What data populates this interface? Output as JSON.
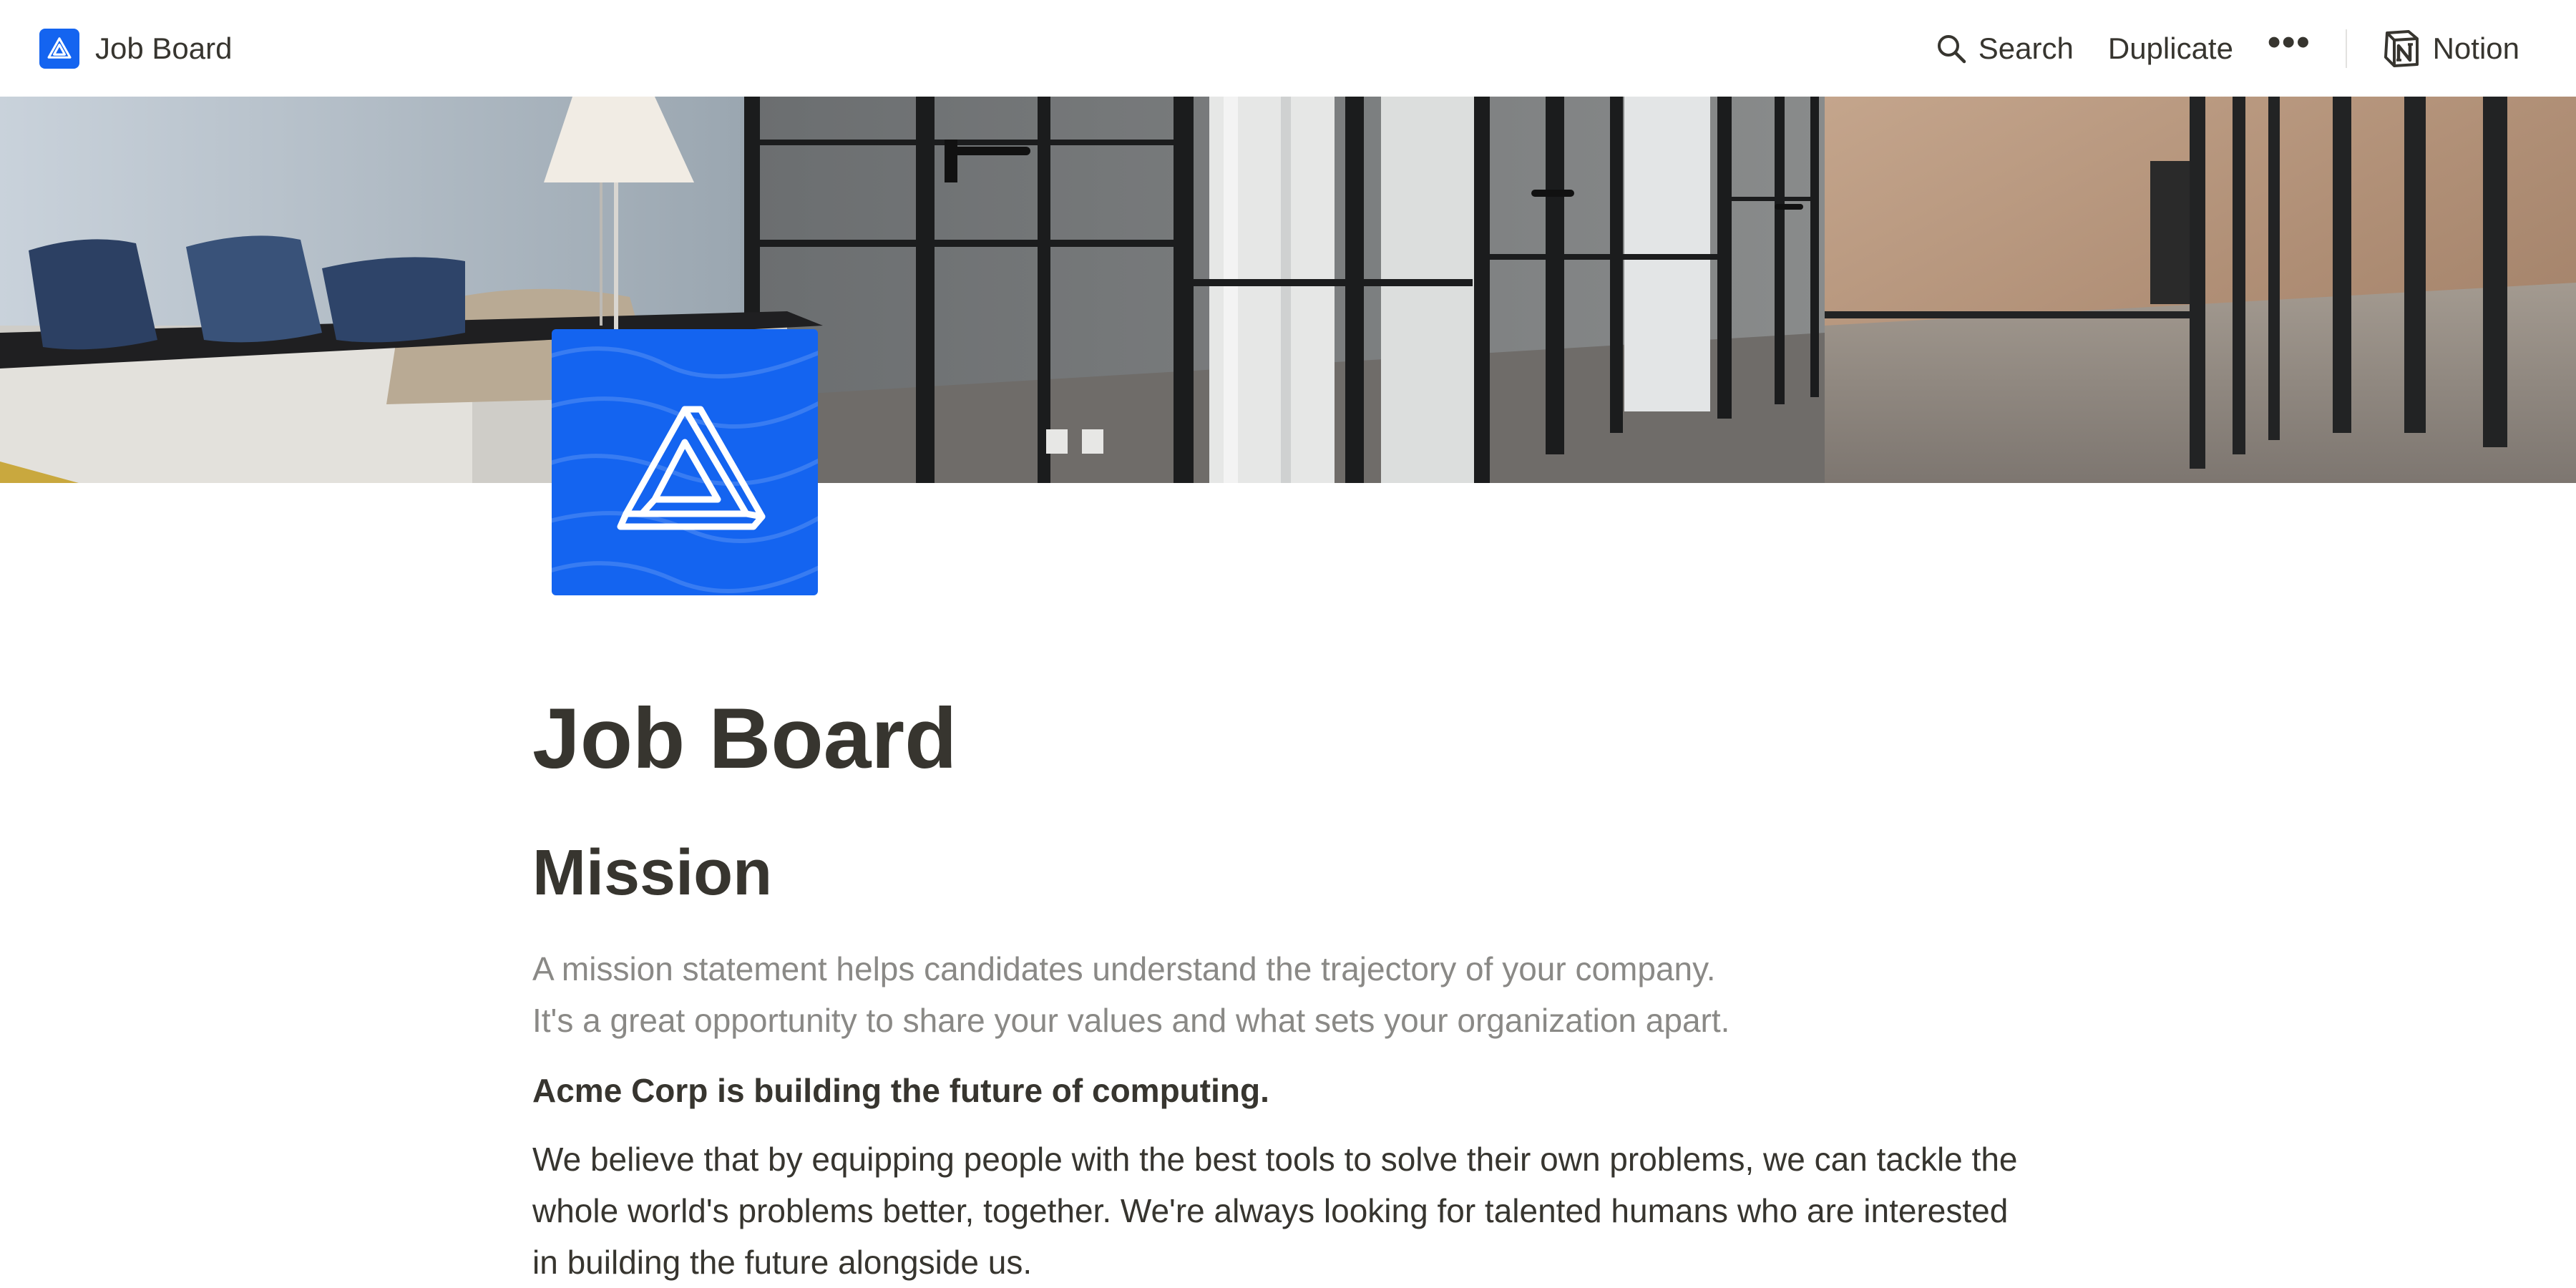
{
  "topbar": {
    "breadcrumb_label": "Job Board",
    "breadcrumb_icon": "triangle-logo-icon",
    "search_label": "Search",
    "duplicate_label": "Duplicate",
    "more_label": "•••",
    "notion_label": "Notion"
  },
  "colors": {
    "brand": "#1464f0",
    "text": "#37352f",
    "muted": "#8a8986"
  },
  "page": {
    "title": "Job Board",
    "icon": "impossible-triangle-icon"
  },
  "mission": {
    "heading": "Mission",
    "hint_line1": "A mission statement helps candidates understand the trajectory of your company.",
    "hint_line2": "It's a great opportunity to share your values and what sets your organization apart.",
    "lead": "Acme Corp is building the future of computing.",
    "body": "We believe that by equipping people with the best tools to solve their own problems, we can tackle the whole world's problems better, together. We're always looking for talented humans who are interested in building the future alongside us."
  }
}
